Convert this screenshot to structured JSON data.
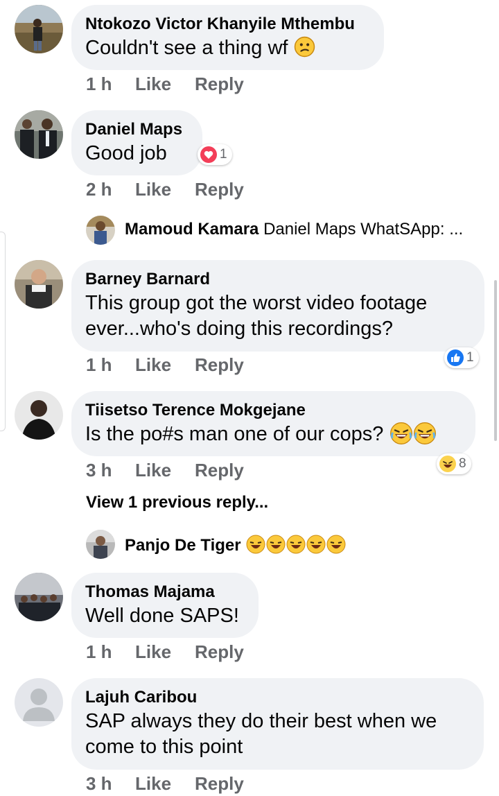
{
  "comments": [
    {
      "author": "Ntokozo Victor Khanyile Mthembu",
      "text": "Couldn't see a thing wf",
      "time": "1 h",
      "like": "Like",
      "reply": "Reply"
    },
    {
      "author": "Daniel Maps",
      "text": "Good job",
      "time": "2 h",
      "like": "Like",
      "reply": "Reply",
      "reaction_count": "1"
    },
    {
      "author": "Barney Barnard",
      "text_line1": "This group got the worst video footage",
      "text_line2": "ever...who's doing this recordings?",
      "time": "1 h",
      "like": "Like",
      "reply": "Reply",
      "reaction_count": "1"
    },
    {
      "author": "Tiisetso Terence Mokgejane",
      "text": "Is the po#s man one of our cops?",
      "time": "3 h",
      "like": "Like",
      "reply": "Reply",
      "reaction_count": "8"
    },
    {
      "author": "Thomas Majama",
      "text": "Well done SAPS!",
      "time": "1 h",
      "like": "Like",
      "reply": "Reply"
    },
    {
      "author": "Lajuh Caribou",
      "text_line1": "SAP always they do their best  when we",
      "text_line2": "come to this point",
      "time": "3 h",
      "like": "Like",
      "reply": "Reply"
    }
  ],
  "replies": [
    {
      "author": "Mamoud Kamara",
      "preview": "Daniel Maps WhatSApp: ..."
    },
    {
      "author": "Panjo De Tiger",
      "preview": ""
    }
  ],
  "view_previous": "View 1 previous reply...",
  "icons": {
    "reaction_love": "heart-icon",
    "reaction_like": "thumbs-up-icon",
    "reaction_haha": "laughing-icon",
    "emoji_confused": "confused-face-icon"
  },
  "colors": {
    "bubble": "#f0f2f5",
    "meta": "#65676b",
    "like_blue": "#1877f2",
    "love_red": "#f33e58",
    "haha_yellow": "#fbd24d"
  }
}
